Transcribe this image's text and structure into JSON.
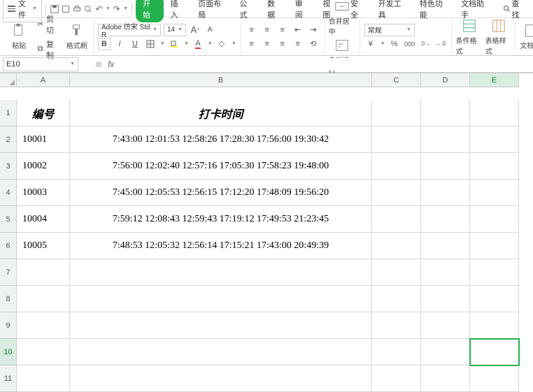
{
  "menubar": {
    "file_label": "文件",
    "tabs": [
      "开始",
      "插入",
      "页面布局",
      "公式",
      "数据",
      "审阅",
      "视图",
      "安全",
      "开发工具",
      "特色功能",
      "文档助手"
    ],
    "active_tab_index": 0,
    "search_label": "查找"
  },
  "ribbon": {
    "paste_label": "粘贴",
    "cut_label": "剪切",
    "copy_label": "复制",
    "format_painter_label": "格式刷",
    "font_name": "Adobe 仿宋 Std R",
    "font_size": "14",
    "merge_center_label": "合并居中",
    "wrap_text_label": "自动换行",
    "number_format": "常规",
    "cond_format_label": "条件格式",
    "table_style_label": "表格样式",
    "doc_assist_label": "文档助"
  },
  "namebox": {
    "value": "E10"
  },
  "formula": {
    "value": ""
  },
  "columns": [
    "A",
    "B",
    "C",
    "D",
    "E"
  ],
  "rows": [
    "1",
    "2",
    "3",
    "4",
    "5",
    "6",
    "7",
    "8",
    "9",
    "10",
    "11"
  ],
  "headers": {
    "col_a": "编号",
    "col_b": "打卡时间"
  },
  "data": [
    {
      "id": "10001",
      "times": "7:43:00 12:01:53 12:58:26 17:28:30 17:56:00 19:30:42"
    },
    {
      "id": "10002",
      "times": "7:56:00 12:02:40 12:57:16 17:05:30 17:58:23 19:48:00"
    },
    {
      "id": "10003",
      "times": "7:45:00 12:05:53 12:56:15 17:12:20 17:48:09 19:56:20"
    },
    {
      "id": "10004",
      "times": "7:59:12 12:08:43 12:59:43 17:19:12 17:49:53 21:23:45"
    },
    {
      "id": "10005",
      "times": "7:48:53 12:05:32 12:56:14 17:15:21 17:43:00 20:49:39"
    }
  ],
  "selected_cell": {
    "row": 10,
    "col": "E"
  }
}
